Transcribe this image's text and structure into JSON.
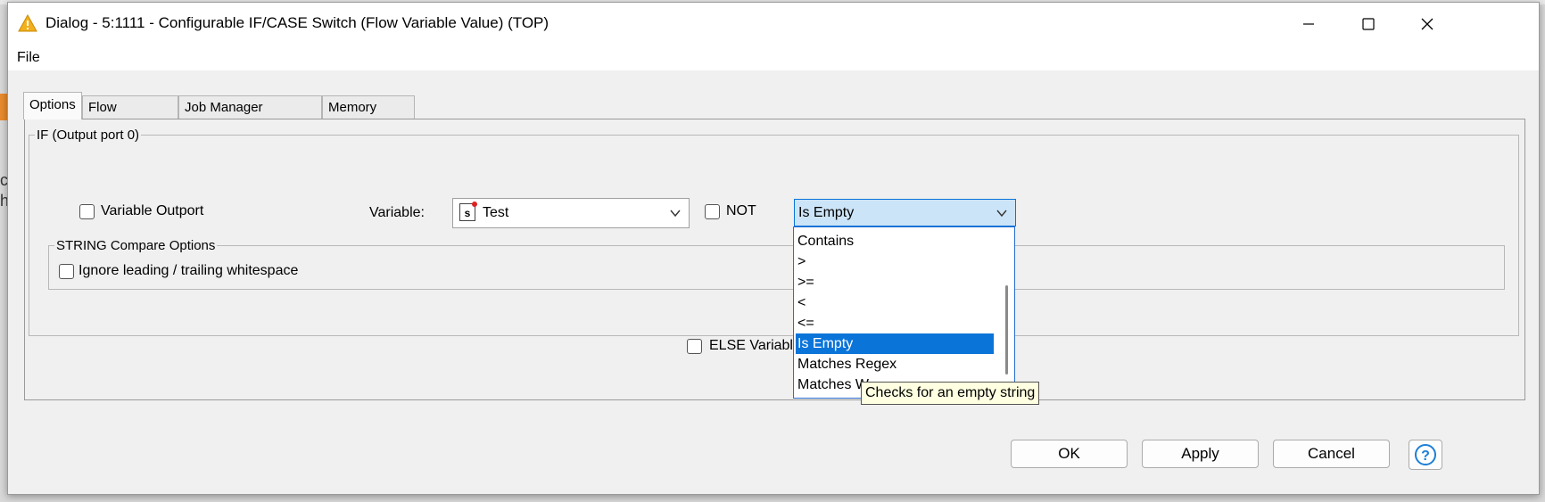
{
  "window": {
    "title": "Dialog - 5:1111 - Configurable IF/CASE Switch (Flow Variable Value) (TOP)"
  },
  "menu": {
    "file": "File"
  },
  "tabs": [
    {
      "label": "Options",
      "active": true
    },
    {
      "label": "Flow Variables",
      "active": false
    },
    {
      "label": "Job Manager Selection",
      "active": false
    },
    {
      "label": "Memory Policy",
      "active": false
    }
  ],
  "if_group": {
    "legend": "IF (Output port 0)",
    "variable_outport": {
      "label": "Variable Outport",
      "checked": false
    },
    "variable_label": "Variable:",
    "variable_value": "Test",
    "variable_type_icon": "s",
    "not": {
      "label": "NOT",
      "checked": false
    },
    "operator_selected": "Is Empty",
    "string_options": {
      "legend": "STRING Compare Options",
      "ignore_whitespace": {
        "label": "Ignore leading / trailing whitespace",
        "checked": false
      }
    }
  },
  "else": {
    "label": "ELSE Variable O",
    "checked": false
  },
  "dropdown": {
    "options": [
      "Contains",
      ">",
      ">=",
      "<",
      "<=",
      "Is Empty",
      "Matches Regex",
      "Matches W"
    ],
    "selected": "Is Empty"
  },
  "tooltip": "Checks for an empty string",
  "buttons": {
    "ok": "OK",
    "apply": "Apply",
    "cancel": "Cancel"
  },
  "colors": {
    "selection": "#0a74d9",
    "tooltip_bg": "#ffffe1",
    "warning_icon": "#f2b01e"
  }
}
